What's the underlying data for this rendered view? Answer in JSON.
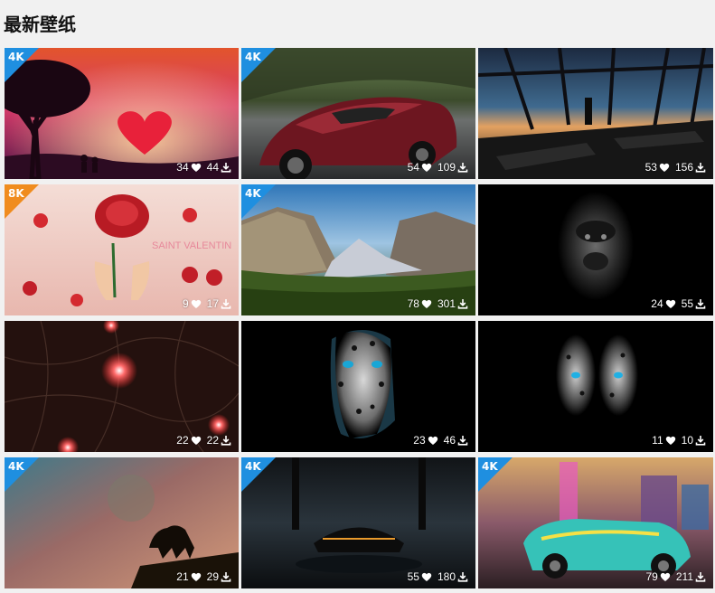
{
  "page": {
    "title": "最新壁纸"
  },
  "accent": {
    "badge_4k": "#1f8fe0",
    "badge_8k": "#f08c1e"
  },
  "wallpapers": [
    {
      "badge": "4K",
      "likes": "34",
      "downloads": "44",
      "subject": "valentine-silhouettes-heart"
    },
    {
      "badge": "4K",
      "likes": "54",
      "downloads": "109",
      "subject": "red-sports-car"
    },
    {
      "badge": "",
      "likes": "53",
      "downloads": "156",
      "subject": "office-window-sunset"
    },
    {
      "badge": "8K",
      "likes": "9",
      "downloads": "17",
      "subject": "saint-valentin-roses"
    },
    {
      "badge": "4K",
      "likes": "78",
      "downloads": "301",
      "subject": "yosemite-valley"
    },
    {
      "badge": "",
      "likes": "24",
      "downloads": "55",
      "subject": "gorilla-dark"
    },
    {
      "badge": "",
      "likes": "22",
      "downloads": "22",
      "subject": "red-bokeh-lights"
    },
    {
      "badge": "",
      "likes": "23",
      "downloads": "46",
      "subject": "snow-leopard"
    },
    {
      "badge": "",
      "likes": "11",
      "downloads": "10",
      "subject": "leopard-eyes-dark"
    },
    {
      "badge": "4K",
      "likes": "21",
      "downloads": "29",
      "subject": "lion-silhouette-cosmos"
    },
    {
      "badge": "4K",
      "likes": "55",
      "downloads": "180",
      "subject": "supercar-dark-garage"
    },
    {
      "badge": "4K",
      "likes": "79",
      "downloads": "211",
      "subject": "cyberpunk-car"
    }
  ],
  "icons": {
    "like": "heart-icon",
    "download": "download-icon"
  },
  "card_text": {
    "valentine": "SAINT VALENTIN"
  }
}
